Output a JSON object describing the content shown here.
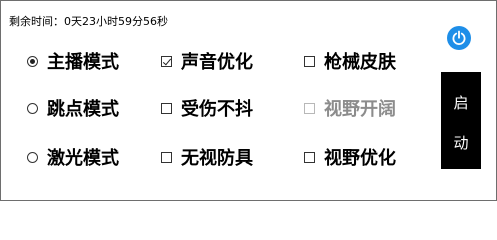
{
  "countdown": {
    "text": "剩余时间：0天23小时59分56秒"
  },
  "options": {
    "mode_streamer": {
      "label": "主播模式",
      "type": "radio",
      "selected": true
    },
    "sound_opt": {
      "label": "声音优化",
      "type": "checkbox",
      "checked": true
    },
    "gun_skin": {
      "label": "枪械皮肤",
      "type": "checkbox",
      "checked": false
    },
    "mode_jump": {
      "label": "跳点模式",
      "type": "radio",
      "selected": false
    },
    "no_shake": {
      "label": "受伤不抖",
      "type": "checkbox",
      "checked": false
    },
    "wide_view": {
      "label": "视野开阔",
      "type": "checkbox",
      "checked": false,
      "disabled": true
    },
    "mode_laser": {
      "label": "激光模式",
      "type": "radio",
      "selected": false
    },
    "no_armor": {
      "label": "无视防具",
      "type": "checkbox",
      "checked": false
    },
    "view_opt": {
      "label": "视野优化",
      "type": "checkbox",
      "checked": false
    }
  },
  "start_button": {
    "char1": "启",
    "char2": "动"
  },
  "icons": {
    "power": "power-icon"
  },
  "colors": {
    "power_button": "#1e8ee8",
    "start_button": "#000000",
    "disabled_text": "#8c8c8c"
  }
}
